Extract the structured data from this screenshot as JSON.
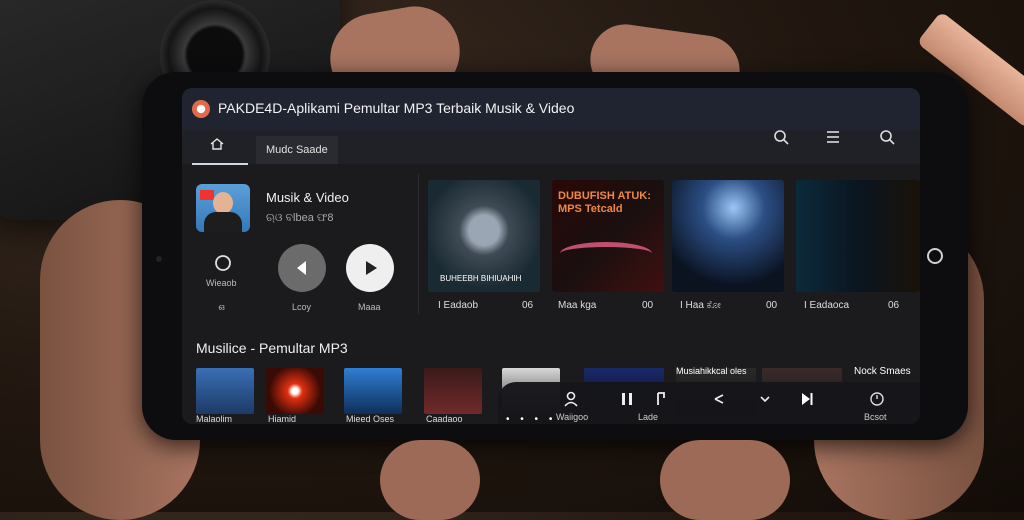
{
  "app": {
    "title": "PAKDE4D-Aplikami Pemultar MP3 Terbaik Musik & Video"
  },
  "nav": {
    "tabs": [
      "Mudc Saade"
    ]
  },
  "now_playing": {
    "title": "Musik & Video",
    "subtitle": "ଋଓ ବlbea ଫ8",
    "controls": [
      {
        "icon": "record-icon",
        "label": "ആഅ"
      },
      {
        "icon": "prev-icon",
        "label": "Lcoy"
      },
      {
        "icon": "play-icon",
        "label": "Maaa"
      }
    ],
    "side_labels": [
      "Wieaob",
      "ഒ"
    ]
  },
  "featured": [
    {
      "label": "I Eadaob",
      "duration": "06",
      "caption": "BUHEEBH BIHIUAHIH"
    },
    {
      "label": "Maa kga",
      "duration": "00",
      "headline": "DUBUFISH ATUK: MPS Tetcald"
    },
    {
      "label": "I Haa ಕೋ",
      "duration": "00"
    },
    {
      "label": "I Eadaoca",
      "duration": "06"
    }
  ],
  "section": {
    "title": "Musilice - Pemultar MP3"
  },
  "thumbnails": [
    {
      "caption": "Malaolim"
    },
    {
      "caption": "Hiamid"
    },
    {
      "caption": "Mieed Oses"
    },
    {
      "caption": "Caadaoo"
    },
    {
      "caption": ""
    },
    {
      "caption": ""
    },
    {
      "caption": "Musiahikkcal oles"
    },
    {
      "caption": "Nock Smaes"
    }
  ],
  "mini_player": {
    "labels": [
      "Waiigoo",
      "Lade",
      "Bcsot"
    ],
    "dots": "• • • •"
  },
  "colors": {
    "screen_bg": "#1b1b1e",
    "titlebar_bg": "#1f2430",
    "play_button": "#efefef",
    "prev_button": "#6b6b6b"
  }
}
